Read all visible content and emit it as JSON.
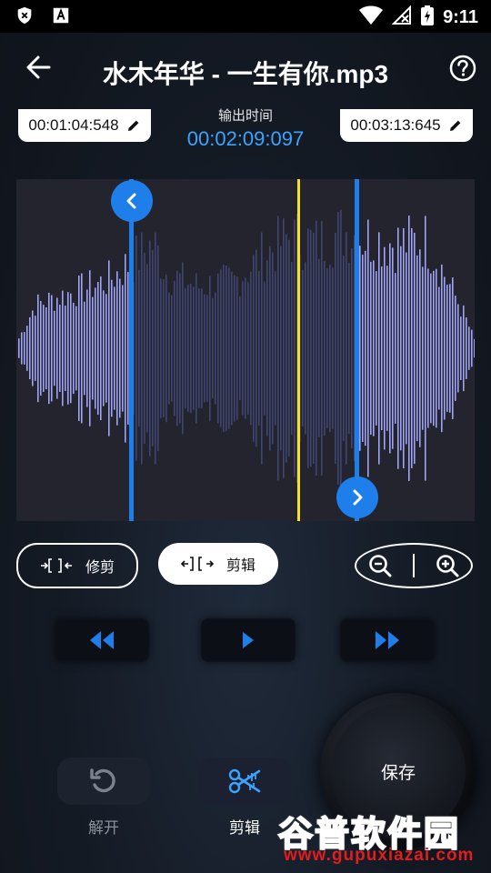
{
  "status_bar": {
    "time": "9:11",
    "icons": [
      "shield-x-icon",
      "font-icon",
      "wifi-icon",
      "no-signal-icon",
      "battery-charging-icon"
    ]
  },
  "appbar": {
    "title": "水木年华 - 一生有你.mp3",
    "back_icon": "arrow-left-icon",
    "help_icon": "help-circle-icon"
  },
  "selection": {
    "start_time": "00:01:04:548",
    "end_time": "00:03:13:645",
    "output_label": "输出时间",
    "output_time": "00:02:09:097",
    "edit_icon": "pencil-icon"
  },
  "colors": {
    "accent": "#1e7eea",
    "wave_light": "#9fa3f5",
    "wave_dim": "#3f4570",
    "playhead": "#f7e21e",
    "output_time": "#3aa4ff"
  },
  "modes": {
    "trim_label": "修剪",
    "cut_label": "剪辑",
    "selected": "cut"
  },
  "playback": {
    "rewind_icon": "rewind-icon",
    "play_icon": "play-icon",
    "forward_icon": "fast-forward-icon"
  },
  "zoom": {
    "out_icon": "zoom-out-icon",
    "in_icon": "zoom-in-icon"
  },
  "actions": {
    "save_label": "保存",
    "undo_label": "解开",
    "cutter_label": "剪辑"
  },
  "watermark": {
    "cn": "谷普软件园",
    "url": "www.gupuxiazai.com"
  }
}
